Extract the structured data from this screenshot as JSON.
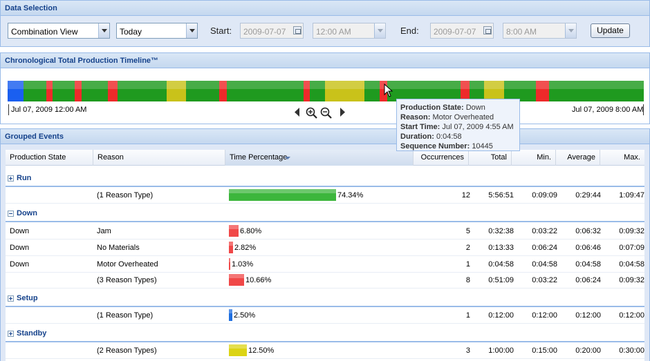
{
  "data_selection": {
    "title": "Data Selection",
    "view_value": "Combination View",
    "period_value": "Today",
    "start_label": "Start:",
    "start_date": "2009-07-07",
    "start_time": "12:00 AM",
    "end_label": "End:",
    "end_date": "2009-07-07",
    "end_time": "8:00 AM",
    "update_label": "Update"
  },
  "timeline": {
    "title": "Chronological Total Production Timeline™",
    "start_label": "Jul 07, 2009 12:00 AM",
    "end_label": "Jul 07, 2009 8:00 AM",
    "colors": {
      "run": "#1f9a1f",
      "down": "#ee2a2a",
      "setup": "#1a5ff0",
      "standby": "#c9c21a"
    },
    "segments": [
      {
        "state": "setup",
        "w": 23
      },
      {
        "state": "run",
        "w": 33
      },
      {
        "state": "down",
        "w": 9
      },
      {
        "state": "run",
        "w": 32
      },
      {
        "state": "down",
        "w": 10
      },
      {
        "state": "run",
        "w": 38
      },
      {
        "state": "down",
        "w": 14
      },
      {
        "state": "run",
        "w": 71
      },
      {
        "state": "standby",
        "w": 28
      },
      {
        "state": "run",
        "w": 48
      },
      {
        "state": "down",
        "w": 11
      },
      {
        "state": "run",
        "w": 111
      },
      {
        "state": "down",
        "w": 9
      },
      {
        "state": "run",
        "w": 22
      },
      {
        "state": "standby",
        "w": 57
      },
      {
        "state": "run",
        "w": 22
      },
      {
        "state": "down",
        "w": 11
      },
      {
        "state": "run",
        "w": 106
      },
      {
        "state": "down",
        "w": 13
      },
      {
        "state": "run",
        "w": 21
      },
      {
        "state": "standby",
        "w": 29
      },
      {
        "state": "run",
        "w": 46
      },
      {
        "state": "down",
        "w": 19
      },
      {
        "state": "run",
        "w": 137
      }
    ]
  },
  "tooltip": {
    "state_label": "Production State:",
    "state_value": "Down",
    "reason_label": "Reason:",
    "reason_value": "Motor Overheated",
    "start_label": "Start Time:",
    "start_value": "Jul 07, 2009 4:55 AM",
    "duration_label": "Duration:",
    "duration_value": "0:04:58",
    "seq_label": "Sequence Number:",
    "seq_value": "10445"
  },
  "grouped": {
    "title": "Grouped Events",
    "columns": [
      "Production State",
      "Reason",
      "Time Percentage",
      "Occurrences",
      "Total",
      "Min.",
      "Average",
      "Max."
    ],
    "groups": [
      {
        "name": "Run",
        "expanded": false,
        "color": "#3cb63c",
        "rows": [],
        "summary": {
          "reason": "(1 Reason Type)",
          "pct": 74.34,
          "pct_label": "74.34%",
          "occ": "12",
          "total": "5:56:51",
          "min": "0:09:09",
          "avg": "0:29:44",
          "max": "1:09:47"
        }
      },
      {
        "name": "Down",
        "expanded": true,
        "color": "#f04848",
        "rows": [
          {
            "state": "Down",
            "reason": "Jam",
            "pct": 6.8,
            "pct_label": "6.80%",
            "occ": "5",
            "total": "0:32:38",
            "min": "0:03:22",
            "avg": "0:06:32",
            "max": "0:09:32"
          },
          {
            "state": "Down",
            "reason": "No Materials",
            "pct": 2.82,
            "pct_label": "2.82%",
            "occ": "2",
            "total": "0:13:33",
            "min": "0:06:24",
            "avg": "0:06:46",
            "max": "0:07:09"
          },
          {
            "state": "Down",
            "reason": "Motor Overheated",
            "pct": 1.03,
            "pct_label": "1.03%",
            "occ": "1",
            "total": "0:04:58",
            "min": "0:04:58",
            "avg": "0:04:58",
            "max": "0:04:58"
          }
        ],
        "summary": {
          "reason": "(3 Reason Types)",
          "pct": 10.66,
          "pct_label": "10.66%",
          "occ": "8",
          "total": "0:51:09",
          "min": "0:03:22",
          "avg": "0:06:24",
          "max": "0:09:32"
        }
      },
      {
        "name": "Setup",
        "expanded": false,
        "color": "#1f6fe0",
        "rows": [],
        "summary": {
          "reason": "(1 Reason Type)",
          "pct": 2.5,
          "pct_label": "2.50%",
          "occ": "1",
          "total": "0:12:00",
          "min": "0:12:00",
          "avg": "0:12:00",
          "max": "0:12:00"
        }
      },
      {
        "name": "Standby",
        "expanded": false,
        "color": "#dcd414",
        "rows": [],
        "summary": {
          "reason": "(2 Reason Types)",
          "pct": 12.5,
          "pct_label": "12.50%",
          "occ": "3",
          "total": "1:00:00",
          "min": "0:15:00",
          "avg": "0:20:00",
          "max": "0:30:00"
        }
      }
    ]
  }
}
